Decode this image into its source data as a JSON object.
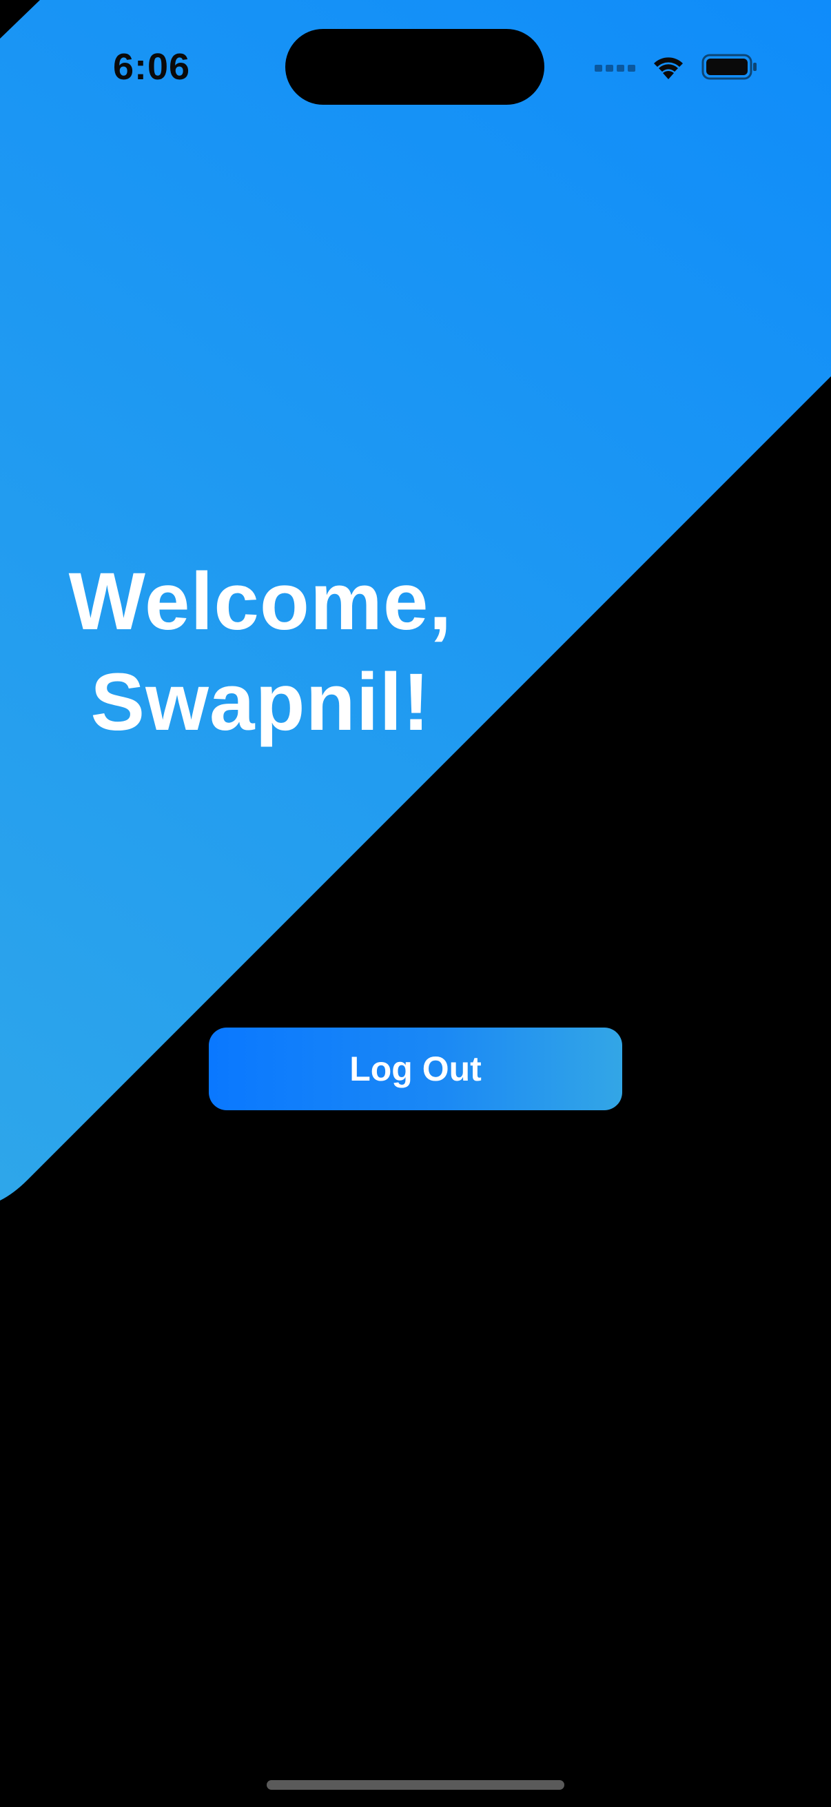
{
  "status_bar": {
    "time": "6:06"
  },
  "welcome": {
    "line1": "Welcome,",
    "line2": "Swapnil!"
  },
  "logout_button": {
    "label": "Log Out"
  },
  "colors": {
    "background": "#000000",
    "accent_top_right": "#0f8cfa",
    "accent_bottom_left": "#2ea6ea",
    "button_start": "#0a78ff",
    "button_end": "#33a6e6",
    "text": "#ffffff"
  },
  "icons": {
    "signal": "cellular-signal-icon",
    "wifi": "wifi-icon",
    "battery": "battery-icon"
  }
}
